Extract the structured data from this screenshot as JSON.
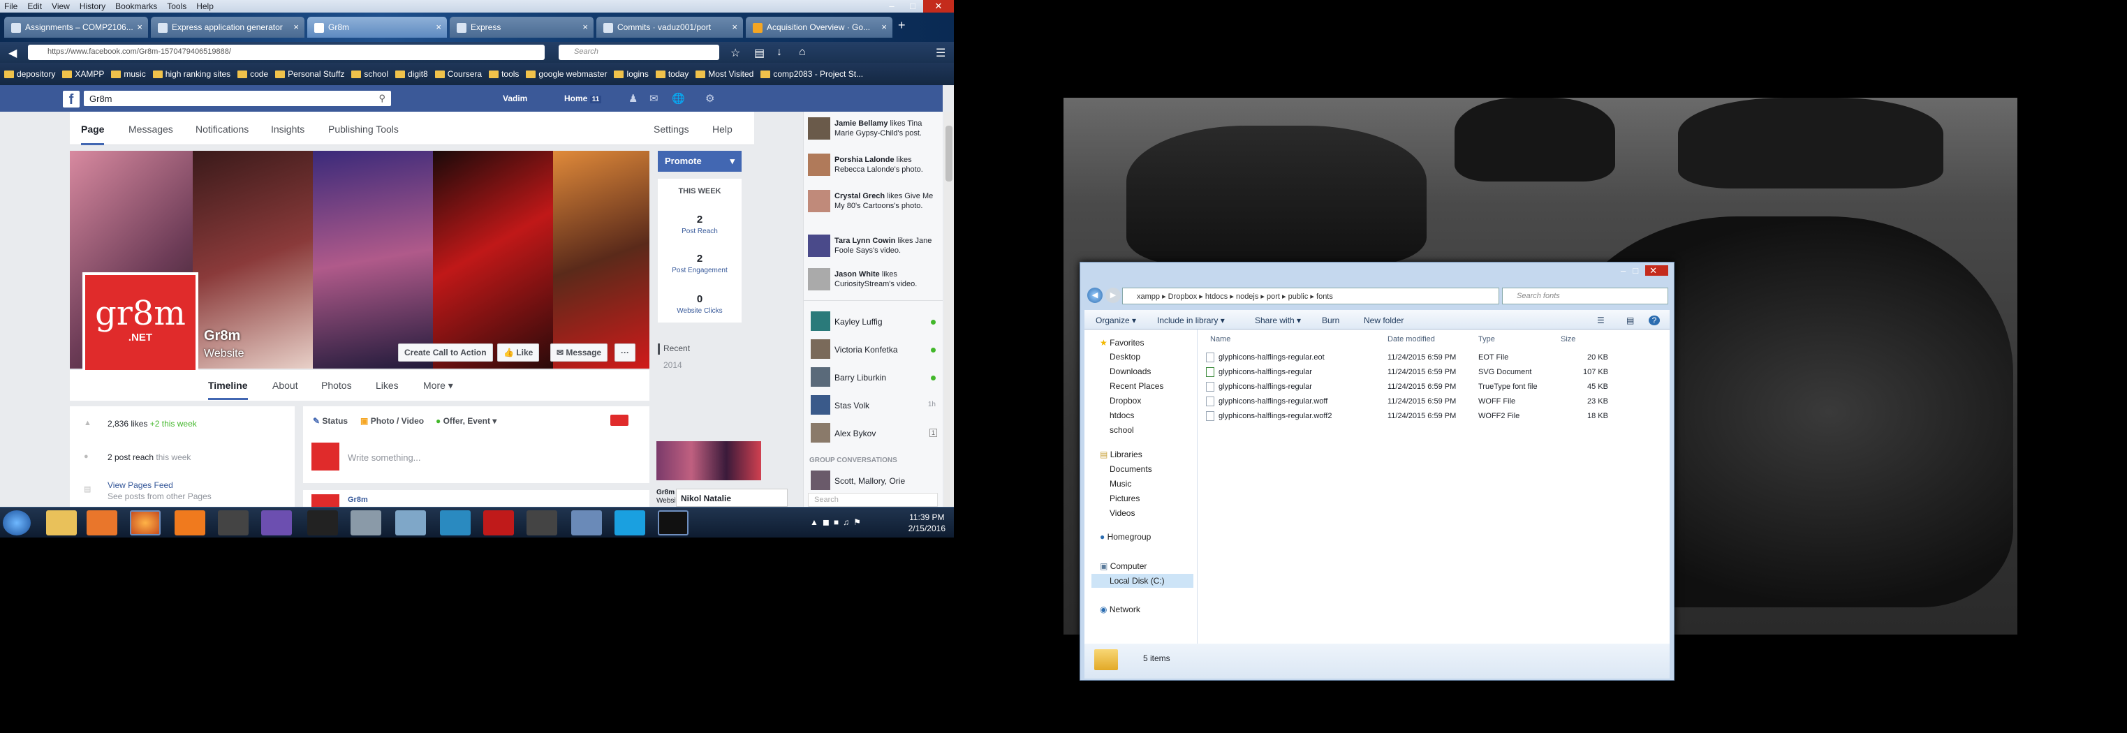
{
  "menubar": [
    "File",
    "Edit",
    "View",
    "History",
    "Bookmarks",
    "Tools",
    "Help"
  ],
  "tabs": [
    {
      "label": "Assignments – COMP2106...",
      "active": false
    },
    {
      "label": "Express application generator",
      "active": false
    },
    {
      "label": "Gr8m",
      "active": true
    },
    {
      "label": "Express",
      "active": false
    },
    {
      "label": "Commits · vaduz001/port",
      "active": false
    },
    {
      "label": "Acquisition Overview · Go...",
      "active": false
    }
  ],
  "address": {
    "url": "https://www.facebook.com/Gr8m-1570479406519888/",
    "search_placeholder": "Search"
  },
  "bookmarks": [
    "depository",
    "XAMPP",
    "music",
    "high ranking sites",
    "code",
    "Personal Stuffz",
    "school",
    "digit8",
    "Coursera",
    "tools",
    "google webmaster",
    "logins",
    "today",
    "Most Visited",
    "comp2083 - Project St..."
  ],
  "fb": {
    "search_value": "Gr8m",
    "user": "Vadim",
    "home_label": "Home",
    "home_count": "11",
    "pagenav": [
      "Page",
      "Messages",
      "Notifications",
      "Insights",
      "Publishing Tools"
    ],
    "settings": "Settings",
    "help": "Help",
    "page_name": "Gr8m",
    "page_type": "Website",
    "logo_text": "gr8m",
    "logo_sub": ".NET",
    "cover_buttons": [
      "Create Call to Action",
      "Like",
      "Message",
      "···"
    ],
    "timeline_tabs": [
      "Timeline",
      "About",
      "Photos",
      "Likes",
      "More"
    ],
    "likes_text": "2,836 likes",
    "likes_delta": "+2 this week",
    "reach_text": "2 post reach",
    "reach_delta": "this week",
    "view_feed": "View Pages Feed",
    "view_feed_sub": "See posts from other Pages",
    "composer_tabs": [
      "Status",
      "Photo / Video",
      "Offer, Event"
    ],
    "composer_placeholder": "Write something...",
    "post_author": "Gr8m",
    "promote": "Promote",
    "this_week": "THIS WEEK",
    "stats": [
      {
        "value": "2",
        "label": "Post Reach"
      },
      {
        "value": "2",
        "label": "Post Engagement"
      },
      {
        "value": "0",
        "label": "Website Clicks"
      }
    ],
    "recent": [
      "Recent",
      "2014"
    ],
    "ticker": [
      {
        "name": "Jamie Bellamy",
        "rest": "likes Tina Marie Gypsy-Child's post."
      },
      {
        "name": "Porshia Lalonde",
        "rest": "likes Rebecca Lalonde's photo."
      },
      {
        "name": "Crystal Grech",
        "rest": "likes Give Me My 80's Cartoons's photo."
      },
      {
        "name": "Tara Lynn Cowin",
        "rest": "likes Jane Foole Says's video."
      },
      {
        "name": "Jason White",
        "rest": "likes CuriosityStream's video."
      }
    ],
    "chat": [
      {
        "name": "Kayley Luffig",
        "status": "online"
      },
      {
        "name": "Victoria Konfetka",
        "status": "online"
      },
      {
        "name": "Barry Liburkin",
        "status": "online"
      },
      {
        "name": "Stas Volk",
        "status": "1h"
      },
      {
        "name": "Alex Bykov",
        "status": "1"
      }
    ],
    "group_conv": "GROUP CONVERSATIONS",
    "group_name": "Scott, Mallory, Orie",
    "chat_search": "Search",
    "chat_tab": "Nikol Natalie",
    "side_page_name": "Gr8m",
    "side_page_type": "Websit"
  },
  "taskbar": {
    "time": "11:39 PM",
    "date": "2/15/2016"
  },
  "explorer": {
    "path": [
      "xampp",
      "Dropbox",
      "htdocs",
      "nodejs",
      "port",
      "public",
      "fonts"
    ],
    "search_placeholder": "Search fonts",
    "toolbar": [
      "Organize",
      "Include in library",
      "Share with",
      "Burn",
      "New folder"
    ],
    "nav": {
      "favorites": "Favorites",
      "fav_items": [
        "Desktop",
        "Downloads",
        "Recent Places",
        "Dropbox",
        "htdocs",
        "school"
      ],
      "libraries": "Libraries",
      "lib_items": [
        "Documents",
        "Music",
        "Pictures",
        "Videos"
      ],
      "homegroup": "Homegroup",
      "computer": "Computer",
      "comp_items": [
        "Local Disk (C:)"
      ],
      "network": "Network"
    },
    "headers": [
      "Name",
      "Date modified",
      "Type",
      "Size"
    ],
    "files": [
      {
        "name": "glyphicons-halflings-regular.eot",
        "date": "11/24/2015 6:59 PM",
        "type": "EOT File",
        "size": "20 KB"
      },
      {
        "name": "glyphicons-halflings-regular",
        "date": "11/24/2015 6:59 PM",
        "type": "SVG Document",
        "size": "107 KB"
      },
      {
        "name": "glyphicons-halflings-regular",
        "date": "11/24/2015 6:59 PM",
        "type": "TrueType font file",
        "size": "45 KB"
      },
      {
        "name": "glyphicons-halflings-regular.woff",
        "date": "11/24/2015 6:59 PM",
        "type": "WOFF File",
        "size": "23 KB"
      },
      {
        "name": "glyphicons-halflings-regular.woff2",
        "date": "11/24/2015 6:59 PM",
        "type": "WOFF2 File",
        "size": "18 KB"
      }
    ],
    "status": "5 items"
  }
}
